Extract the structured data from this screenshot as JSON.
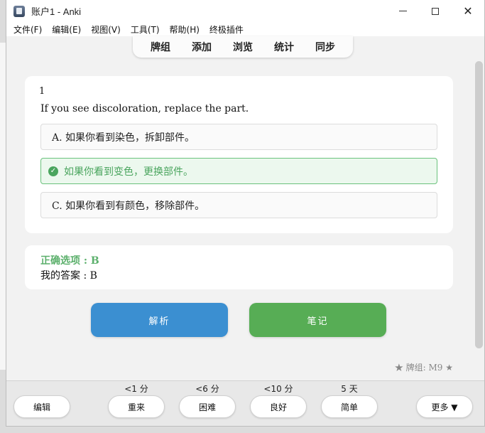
{
  "window": {
    "title": "账户1 - Anki"
  },
  "menu": [
    "文件(F)",
    "编辑(E)",
    "视图(V)",
    "工具(T)",
    "帮助(H)",
    "终极插件"
  ],
  "toolbar": [
    "牌组",
    "添加",
    "浏览",
    "统计",
    "同步"
  ],
  "card": {
    "number": "1",
    "question": "If you see discoloration, replace the part.",
    "options": [
      {
        "text": "A. 如果你看到染色，拆卸部件。",
        "correct": false
      },
      {
        "text": "如果你看到变色，更换部件。",
        "correct": true
      },
      {
        "text": "C. 如果你看到有颜色，移除部件。",
        "correct": false
      }
    ]
  },
  "answer": {
    "correct": "正确选项 : B",
    "mine": "我的答案 : B"
  },
  "buttons": {
    "explain": "解析",
    "notes": "笔记"
  },
  "deck": "★ 牌组:  M9 ★",
  "bottom": {
    "edit": "编辑",
    "more": "更多 ▼",
    "answers": [
      {
        "interval": "<1 分",
        "label": "重来"
      },
      {
        "interval": "<6 分",
        "label": "困难"
      },
      {
        "interval": "<10 分",
        "label": "良好"
      },
      {
        "interval": "5 天",
        "label": "简单"
      }
    ]
  },
  "colors": {
    "correct": "#4aa55e",
    "explain_btn": "#3b8fd1",
    "notes_btn": "#57ad55"
  }
}
